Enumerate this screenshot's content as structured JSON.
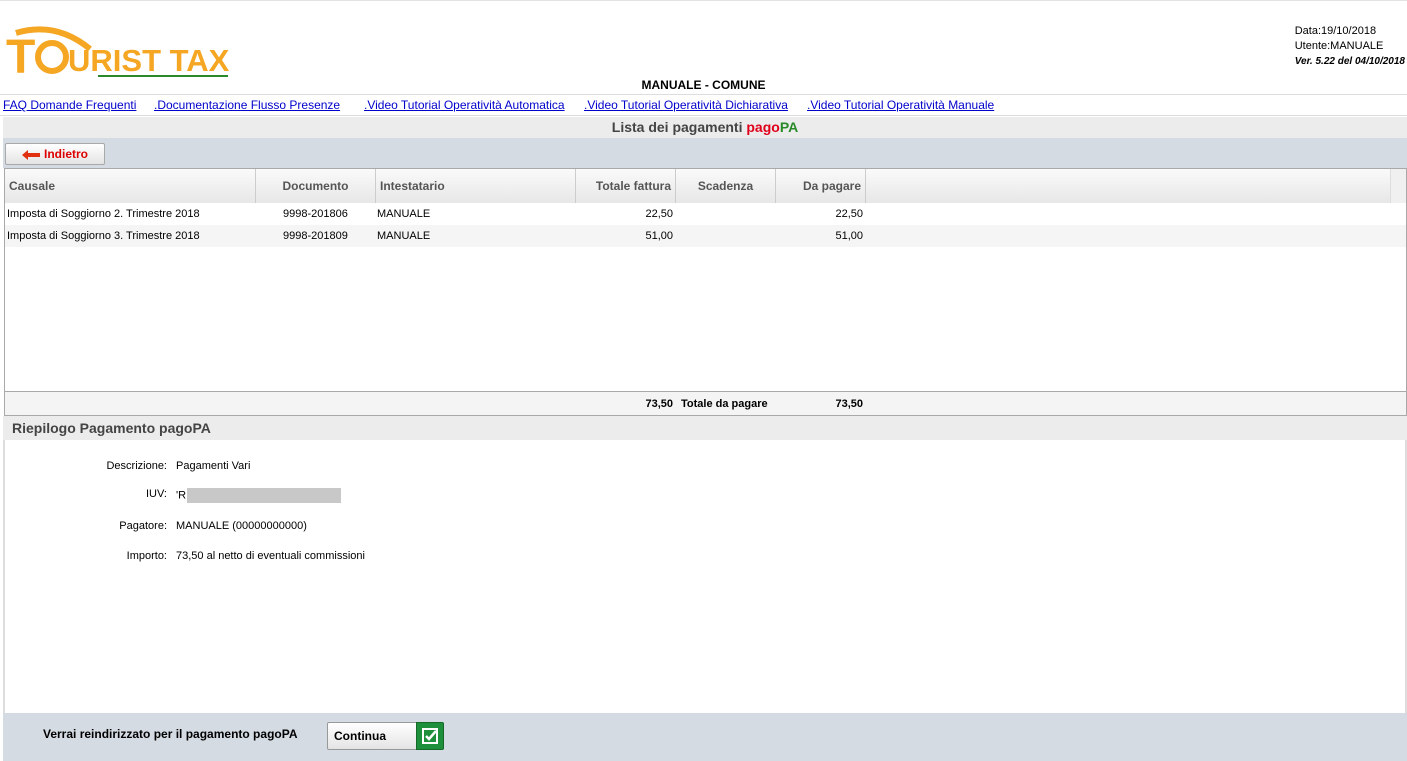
{
  "header": {
    "logo_text": "TOURIST TAX",
    "date_label": "Data:19/10/2018",
    "user_label": "Utente:MANUALE",
    "version_label": "Ver. 5.22 del 04/10/2018",
    "comune": "MANUALE - COMUNE"
  },
  "links": [
    "FAQ Domande Frequenti",
    ".Documentazione Flusso Presenze",
    ".Video Tutorial Operatività Automatica",
    ".Video Tutorial Operatività Dichiarativa",
    ".Video Tutorial Operatività Manuale"
  ],
  "list": {
    "title_prefix": "Lista dei pagamenti ",
    "title_pago": "pago",
    "title_pa": "PA",
    "back_label": "Indietro"
  },
  "table": {
    "columns": [
      "Causale",
      "Documento",
      "Intestatario",
      "Totale fattura",
      "Scadenza",
      "Da pagare"
    ],
    "rows": [
      [
        "Imposta di Soggiorno 2. Trimestre 2018",
        "9998-201806",
        "MANUALE",
        "22,50",
        "",
        "22,50"
      ],
      [
        "Imposta di Soggiorno 3. Trimestre 2018",
        "9998-201809",
        "MANUALE",
        "51,00",
        "",
        "51,00"
      ]
    ],
    "total_fattura": "73,50",
    "total_label": "Totale da pagare",
    "total_da_pagare": "73,50"
  },
  "riepilogo": {
    "title": "Riepilogo Pagamento pagoPA",
    "fields": [
      {
        "label": "Descrizione:",
        "value": "Pagamenti Vari"
      },
      {
        "label": "IUV:",
        "value": "'R"
      },
      {
        "label": "Pagatore:",
        "value": "MANUALE (00000000000)"
      },
      {
        "label": "Importo:",
        "value": "73,50 al netto di eventuali commissioni"
      }
    ]
  },
  "footer": {
    "message": "Verrai reindirizzato per il pagamento pagoPA",
    "continue_label": "Continua"
  },
  "colors": {
    "logo_orange": "#f5a623",
    "logo_green": "#2a8a2a",
    "link_blue": "#0000cc",
    "pago_red": "#e0001a",
    "continue_green": "#1e8f3a"
  }
}
